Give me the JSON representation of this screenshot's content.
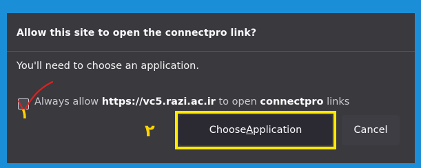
{
  "dialog": {
    "title": "Allow this site to open the connectpro link?",
    "description": "You'll need to choose an application.",
    "checkbox": {
      "checked": true,
      "prefix": "Always allow ",
      "site": "https://vc5.razi.ac.ir",
      "middle": " to open ",
      "scheme": "connectpro",
      "suffix": " links"
    },
    "buttons": {
      "choose_before": "Choose ",
      "choose_accesskey": "A",
      "choose_after": "pplication",
      "cancel": "Cancel"
    }
  },
  "annotations": {
    "step1": "١",
    "step2": "٢",
    "highlight_color": "#ffeb00",
    "check_color": "#e02020"
  }
}
